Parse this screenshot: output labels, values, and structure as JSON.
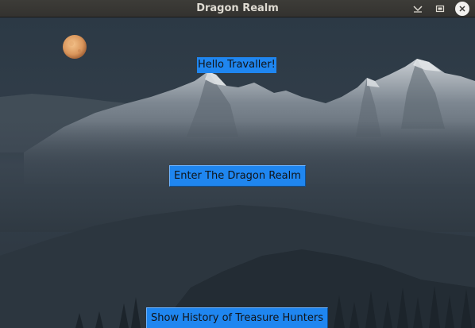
{
  "window": {
    "title": "Dragon Realm",
    "controls": {
      "minimize_icon": "minimize-icon",
      "maximize_icon": "maximize-icon",
      "close_icon": "close-icon"
    }
  },
  "background": {
    "description_icon": "moon-icon"
  },
  "main": {
    "greeting": "Hello Travaller!",
    "enter_button": "Enter The Dragon Realm",
    "history_button": "Show History of Treasure Hunters"
  },
  "colors": {
    "accent": "#1f86f0",
    "titlebar": "#3a3936",
    "sky": "#2a3540"
  }
}
